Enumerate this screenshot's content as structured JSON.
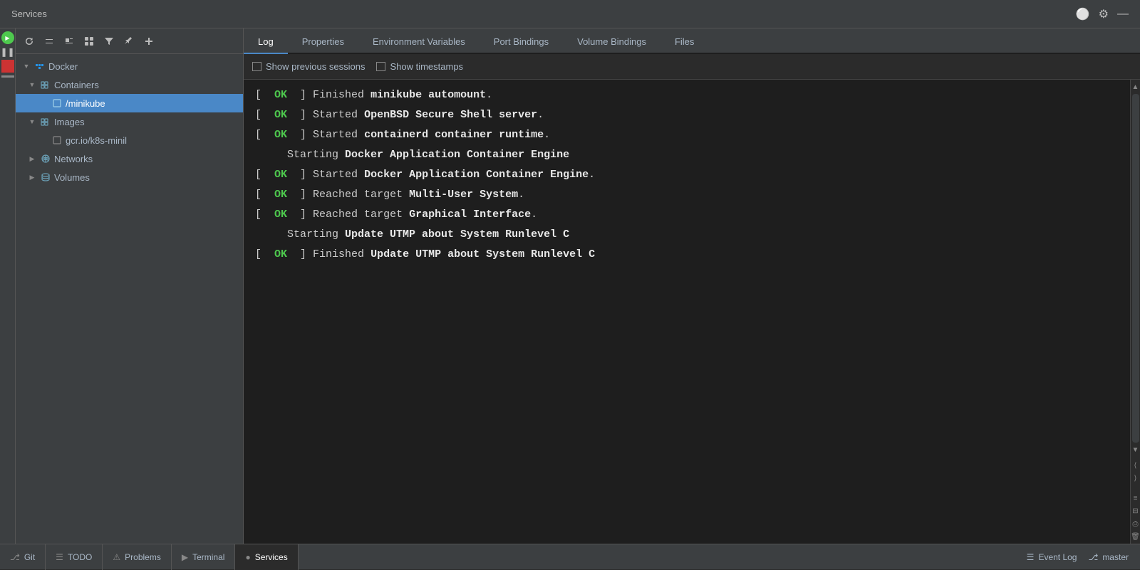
{
  "titleBar": {
    "title": "Services",
    "icons": [
      "globe-icon",
      "gear-icon",
      "minimize-icon"
    ]
  },
  "sidebar": {
    "toolbarButtons": [
      "refresh-icon",
      "collapse-all-icon",
      "expand-all-icon",
      "layout-icon",
      "filter-icon",
      "pin-icon",
      "add-icon"
    ],
    "tree": [
      {
        "id": "docker",
        "label": "Docker",
        "level": 0,
        "expanded": true,
        "hasArrow": true,
        "icon": "docker-icon"
      },
      {
        "id": "containers",
        "label": "Containers",
        "level": 1,
        "expanded": true,
        "hasArrow": true,
        "icon": "containers-icon"
      },
      {
        "id": "minikube",
        "label": "/minikube",
        "level": 2,
        "expanded": false,
        "hasArrow": false,
        "icon": "container-icon",
        "selected": true
      },
      {
        "id": "images",
        "label": "Images",
        "level": 1,
        "expanded": true,
        "hasArrow": true,
        "icon": "images-icon"
      },
      {
        "id": "gcr-image",
        "label": "gcr.io/k8s-minil",
        "level": 2,
        "expanded": false,
        "hasArrow": false,
        "icon": "image-icon"
      },
      {
        "id": "networks",
        "label": "Networks",
        "level": 1,
        "expanded": false,
        "hasArrow": true,
        "icon": "networks-icon"
      },
      {
        "id": "volumes",
        "label": "Volumes",
        "level": 1,
        "expanded": false,
        "hasArrow": true,
        "icon": "volumes-icon"
      }
    ]
  },
  "tabs": [
    {
      "id": "log",
      "label": "Log",
      "active": true
    },
    {
      "id": "properties",
      "label": "Properties",
      "active": false
    },
    {
      "id": "env-vars",
      "label": "Environment Variables",
      "active": false
    },
    {
      "id": "port-bindings",
      "label": "Port Bindings",
      "active": false
    },
    {
      "id": "volume-bindings",
      "label": "Volume Bindings",
      "active": false
    },
    {
      "id": "files",
      "label": "Files",
      "active": false
    }
  ],
  "logToolbar": {
    "showPreviousSessions": "Show previous sessions",
    "showTimestamps": "Show timestamps"
  },
  "logLines": [
    {
      "id": 1,
      "prefix": "[",
      "status": "  OK  ",
      "suffix": "]",
      "text": " Finished ",
      "bold": "minikube automount",
      "end": "."
    },
    {
      "id": 2,
      "prefix": "[",
      "status": "  OK  ",
      "suffix": "]",
      "text": " Started ",
      "bold": "OpenBSD Secure Shell server",
      "end": "."
    },
    {
      "id": 3,
      "prefix": "[",
      "status": "  OK  ",
      "suffix": "]",
      "text": " Started ",
      "bold": "containerd container runtime",
      "end": "."
    },
    {
      "id": 4,
      "prefix": "     ",
      "status": null,
      "suffix": null,
      "text": "     Starting ",
      "bold": "Docker Application Container Engine",
      "end": ""
    },
    {
      "id": 5,
      "prefix": "[",
      "status": "  OK  ",
      "suffix": "]",
      "text": " Started ",
      "bold": "Docker Application Container Engine",
      "end": "."
    },
    {
      "id": 6,
      "prefix": "[",
      "status": "  OK  ",
      "suffix": "]",
      "text": " Reached target ",
      "bold": "Multi-User System",
      "end": "."
    },
    {
      "id": 7,
      "prefix": "[",
      "status": "  OK  ",
      "suffix": "]",
      "text": " Reached target ",
      "bold": "Graphical Interface",
      "end": "."
    },
    {
      "id": 8,
      "prefix": "     ",
      "status": null,
      "suffix": null,
      "text": "     Starting ",
      "bold": "Update UTMP about System Runlevel C",
      "end": ""
    },
    {
      "id": 9,
      "prefix": "[",
      "status": "  OK  ",
      "suffix": "]",
      "text": " Finished ",
      "bold": "Update UTMP about System Runlevel C",
      "end": ""
    }
  ],
  "bottomTabs": [
    {
      "id": "git",
      "label": "Git",
      "icon": "git-icon"
    },
    {
      "id": "todo",
      "label": "TODO",
      "icon": "list-icon"
    },
    {
      "id": "problems",
      "label": "Problems",
      "icon": "warning-icon"
    },
    {
      "id": "terminal",
      "label": "Terminal",
      "icon": "terminal-icon"
    },
    {
      "id": "services",
      "label": "Services",
      "icon": "services-icon",
      "active": true
    }
  ],
  "bottomRight": [
    {
      "id": "event-log",
      "label": "Event Log",
      "icon": "log-icon"
    },
    {
      "id": "master",
      "label": "master",
      "icon": "git-branch-icon"
    }
  ]
}
